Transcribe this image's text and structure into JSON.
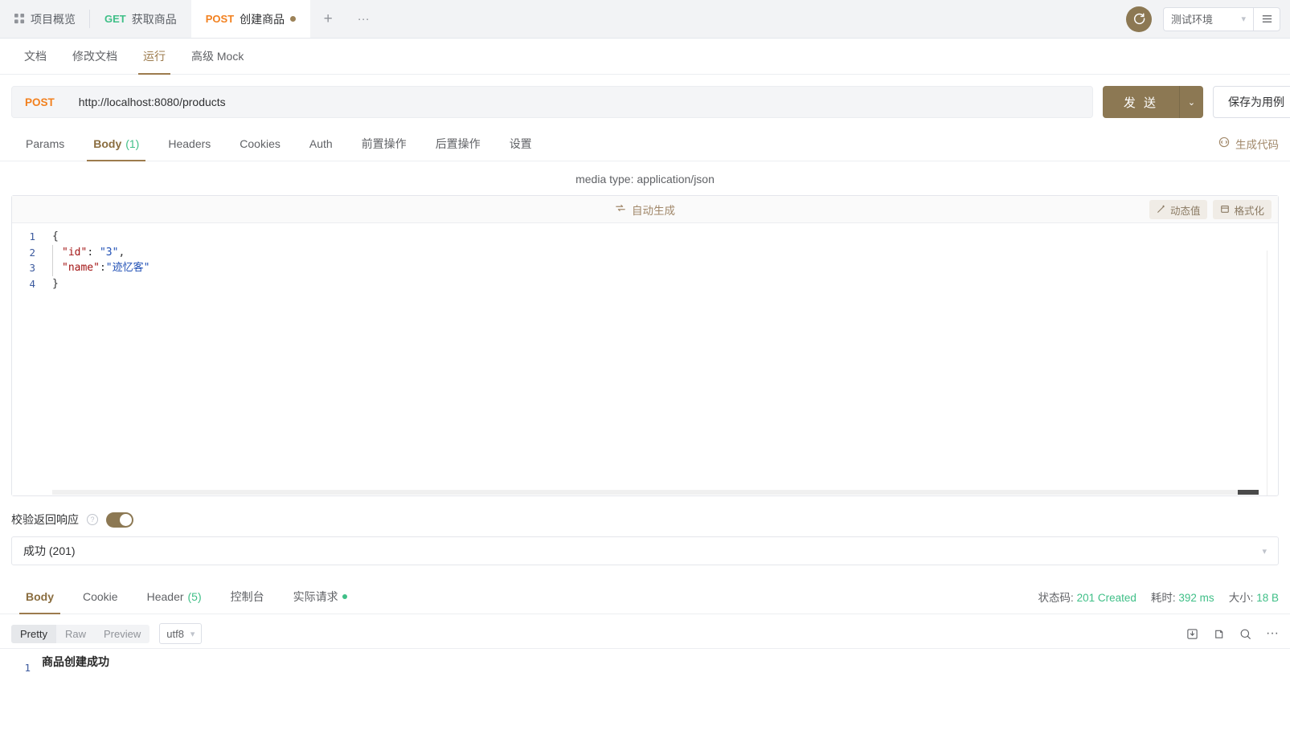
{
  "topbar": {
    "tabs": [
      {
        "icon": "grid-icon",
        "method": "",
        "label": "项目概览"
      },
      {
        "icon": "",
        "method": "GET",
        "label": "获取商品"
      },
      {
        "icon": "",
        "method": "POST",
        "label": "创建商品",
        "dirty": true
      }
    ],
    "add_label": "+",
    "more_label": "···",
    "refresh_icon": "refresh-icon",
    "environment": "测试环境",
    "menu_icon": "hamburger-icon"
  },
  "subnav": {
    "items": [
      "文档",
      "修改文档",
      "运行",
      "高级 Mock"
    ],
    "active_index": 2
  },
  "url": {
    "method": "POST",
    "value": "http://localhost:8080/products",
    "send_label": "发 送",
    "send_caret": "⌄",
    "save_label": "保存为用例"
  },
  "request_tabs": {
    "items": [
      {
        "label": "Params",
        "count": ""
      },
      {
        "label": "Body",
        "count": "(1)"
      },
      {
        "label": "Headers",
        "count": ""
      },
      {
        "label": "Cookies",
        "count": ""
      },
      {
        "label": "Auth",
        "count": ""
      },
      {
        "label": "前置操作",
        "count": ""
      },
      {
        "label": "后置操作",
        "count": ""
      },
      {
        "label": "设置",
        "count": ""
      }
    ],
    "active_index": 1,
    "gen_code_label": "生成代码"
  },
  "body_panel": {
    "media_type": "media type: application/json",
    "auto_generate_label": "自动生成",
    "dynamic_value_label": "动态值",
    "format_label": "格式化",
    "line_numbers": [
      "1",
      "2",
      "3",
      "4"
    ],
    "code": [
      {
        "segments": [
          {
            "t": "{",
            "c": "pun"
          }
        ],
        "indent": false
      },
      {
        "segments": [
          {
            "t": "\"id\"",
            "c": "key"
          },
          {
            "t": ": ",
            "c": "pun"
          },
          {
            "t": "\"3\"",
            "c": "str"
          },
          {
            "t": ",",
            "c": "pun"
          }
        ],
        "indent": true
      },
      {
        "segments": [
          {
            "t": "\"name\"",
            "c": "key"
          },
          {
            "t": ":",
            "c": "pun"
          },
          {
            "t": "\"迹忆客\"",
            "c": "str"
          }
        ],
        "indent": true
      },
      {
        "segments": [
          {
            "t": "}",
            "c": "pun"
          }
        ],
        "indent": false
      }
    ]
  },
  "validate": {
    "label": "校验返回响应",
    "help_icon": "question-icon",
    "toggle_on": true,
    "selected_response": "成功 (201)"
  },
  "response_tabs": {
    "items": [
      {
        "label": "Body",
        "count": ""
      },
      {
        "label": "Cookie",
        "count": ""
      },
      {
        "label": "Header",
        "count": "(5)"
      },
      {
        "label": "控制台",
        "count": ""
      },
      {
        "label": "实际请求",
        "count": "",
        "dot": true
      }
    ],
    "active_index": 0,
    "meta": {
      "status_label": "状态码:",
      "status_value": "201 Created",
      "time_label": "耗时:",
      "time_value": "392 ms",
      "size_label": "大小:",
      "size_value": "18 B"
    }
  },
  "response_body": {
    "view_modes": [
      "Pretty",
      "Raw",
      "Preview"
    ],
    "active_view": "Pretty",
    "encoding": "utf8",
    "icons": [
      "download-icon",
      "copy-icon",
      "search-icon",
      "more-icon"
    ],
    "line_numbers": [
      "1"
    ],
    "lines": [
      "商品创建成功"
    ]
  },
  "colors": {
    "accent": "#8c7853",
    "method_post": "#f2801e",
    "method_get": "#3fbf87",
    "success": "#3fbf87",
    "json_key": "#a31515",
    "json_string": "#1f4fb5"
  }
}
